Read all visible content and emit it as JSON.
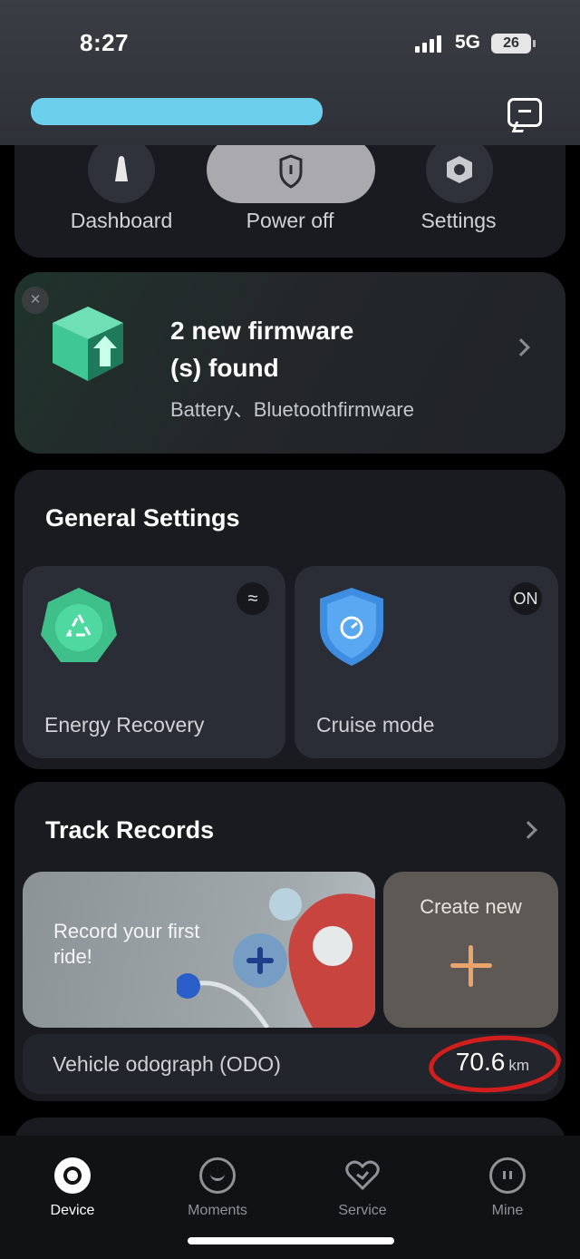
{
  "status_bar": {
    "time": "8:27",
    "network": "5G",
    "battery": "26"
  },
  "quick_actions": [
    {
      "label": "Dashboard",
      "icon": "gauge-icon"
    },
    {
      "label": "Power off",
      "icon": "shield-icon"
    },
    {
      "label": "Settings",
      "icon": "hex-nut-icon"
    }
  ],
  "firmware": {
    "title": "2 new firmware (s) found",
    "title_line1": "2 new firmware",
    "title_line2": "(s) found",
    "subtitle": "Battery、Bluetoothfirmware",
    "close": "×"
  },
  "general_settings": {
    "title": "General Settings",
    "tiles": [
      {
        "label": "Energy Recovery",
        "badge": "≈",
        "icon": "recycle-icon"
      },
      {
        "label": "Cruise mode",
        "badge": "ON",
        "icon": "speedometer-shield-icon"
      }
    ]
  },
  "track_records": {
    "title": "Track Records",
    "record_prompt": "Record your first ride!",
    "create_label": "Create new",
    "odo_label": "Vehicle odograph (ODO)",
    "odo_value": "70.6",
    "odo_unit": "km"
  },
  "tabs": [
    {
      "label": "Device",
      "icon": "device-icon",
      "active": true
    },
    {
      "label": "Moments",
      "icon": "smile-chat-icon",
      "active": false
    },
    {
      "label": "Service",
      "icon": "heart-icon",
      "active": false
    },
    {
      "label": "Mine",
      "icon": "profile-icon",
      "active": false
    }
  ],
  "colors": {
    "accent": "#e9a569",
    "card": "#191b20",
    "tile": "#2a2d35",
    "annotation": "#d31e1e"
  }
}
